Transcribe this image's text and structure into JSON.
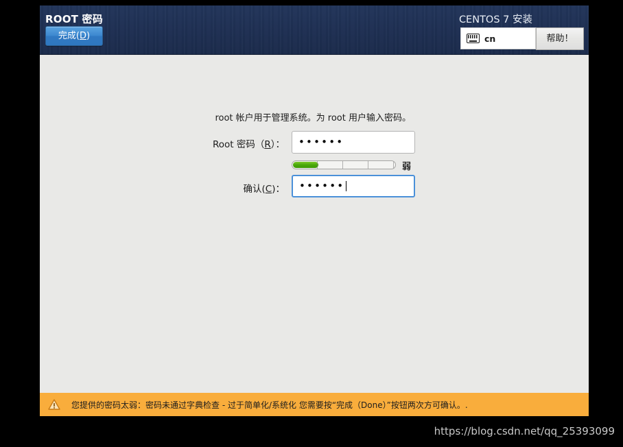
{
  "window": {
    "title": "ROOT 密码",
    "product_title": "CENTOS 7 安装"
  },
  "header": {
    "done_button": "完成(D)",
    "done_button_mnemonic": "D",
    "help_button": "帮助！",
    "keyboard_layout": "cn",
    "keyboard_icon": "keyboard-icon"
  },
  "main": {
    "intro_text": "root 帐户用于管理系统。为 root 用户输入密码。",
    "root_password": {
      "label": "Root 密码（R）：",
      "mnemonic": "R",
      "value": "••••••",
      "char_count": 6,
      "focused": false
    },
    "strength": {
      "label": "弱",
      "percent": 25,
      "segments": 4,
      "fill_color": "#4aa80a"
    },
    "confirm_password": {
      "label": "确认(C)：",
      "mnemonic": "C",
      "value": "••••••",
      "char_count": 6,
      "focused": true
    }
  },
  "warning": {
    "icon": "warning-triangle-icon",
    "text": "您提供的密码太弱：密码未通过字典检查 - 过于简单化/系统化 您需要按“完成（Done）”按钮两次方可确认。.",
    "background_color": "#f9ad3c"
  },
  "watermark": {
    "text": "https://blog.csdn.net/qq_25393099"
  },
  "colors": {
    "header_background": "#1e2f52",
    "content_background": "#e9e9e7",
    "accent_blue": "#3d88cf",
    "focus_blue": "#4a90d9"
  }
}
